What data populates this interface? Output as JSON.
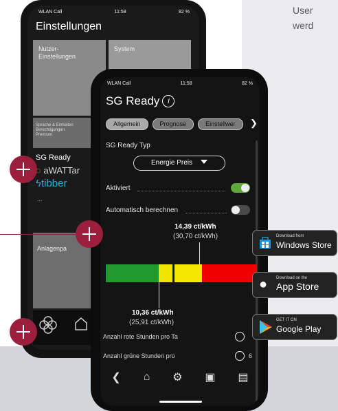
{
  "intro_text": [
    "User",
    "werd"
  ],
  "back_phone": {
    "status_left": "WLAN Call",
    "status_time": "11:58",
    "status_battery": "82 %",
    "title": "Einstellungen",
    "tile_user": "Nutzer-\nEinstellungen",
    "tile_system": "System",
    "tile_lang": "Sprache & Einheiten\nBerechtigungen\nPremium",
    "sg_ready": "SG Ready",
    "awattar": "aWATTar",
    "tibber": "tibber",
    "dots": "...",
    "tile_anlagen": "Anlagenpa"
  },
  "front_phone": {
    "status_left": "WLAN Call",
    "status_time": "11:58",
    "status_battery": "82 %",
    "title": "SG Ready",
    "tabs": [
      "Allgemein",
      "Prognose",
      "Einstellwer"
    ],
    "sg_typ_label": "SG Ready Typ",
    "select_value": "Energie Preis",
    "aktiviert_label": "Aktiviert",
    "aktiviert_on": true,
    "auto_label": "Automatisch berechnen",
    "auto_on": false,
    "price_high": "14,39 ct/kWh",
    "price_high_sub": "(30,70 ct/kWh)",
    "price_low": "10,36 ct/kWh",
    "price_low_sub": "(25,91 ct/kWh)",
    "row_red": "Anzahl rote Stunden pro Ta",
    "row_green": "Anzahl grüne Stunden pro",
    "row_green_value": "6"
  },
  "price_bar": {
    "segments": [
      {
        "color": "#1f9a2e",
        "fraction": 0.35
      },
      {
        "color": "#f0e500",
        "fraction": 0.09
      },
      {
        "color": "#111111",
        "fraction": 0.015
      },
      {
        "color": "#f4e800",
        "fraction": 0.18
      },
      {
        "color": "#f00000",
        "fraction": 0.365
      }
    ],
    "high_marker_fraction": 0.62,
    "low_marker_fraction": 0.35
  },
  "badges": {
    "windows_small": "Download from",
    "windows_big": "Windows Store",
    "apple_small": "Download on the",
    "apple_big": "App Store",
    "google_small": "GET IT ON",
    "google_big": "Google Play"
  },
  "colors": {
    "accent": "#9b1f3d",
    "toggle_on": "#5fa83a"
  }
}
